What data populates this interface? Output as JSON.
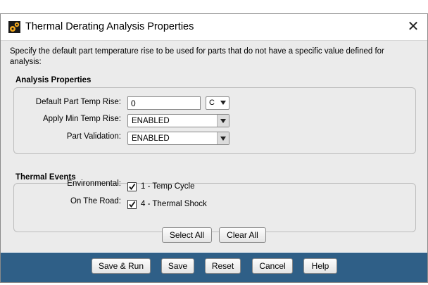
{
  "window": {
    "title": "Thermal Derating Analysis Properties",
    "close_symbol": "✕"
  },
  "description": "Specify the default part temperature rise to be used for parts that do not have a specific value defined for analysis:",
  "analysis_properties": {
    "title": "Analysis Properties",
    "default_temp_rise": {
      "label": "Default Part Temp Rise:",
      "value": "0",
      "unit": "C"
    },
    "apply_min_temp_rise": {
      "label": "Apply Min Temp Rise:",
      "value": "ENABLED"
    },
    "part_validation": {
      "label": "Part Validation:",
      "value": "ENABLED"
    }
  },
  "thermal_events": {
    "title": "Thermal Events",
    "rows": [
      {
        "label": "Environmental:",
        "item": "1 - Temp Cycle",
        "checked": true
      },
      {
        "label": "On The Road:",
        "item": "4 - Thermal Shock",
        "checked": true
      }
    ]
  },
  "buttons": {
    "select_all": "Select All",
    "clear_all": "Clear All",
    "save_run": "Save & Run",
    "save": "Save",
    "reset": "Reset",
    "cancel": "Cancel",
    "help": "Help"
  },
  "colors": {
    "footer_bg": "#2f5f87",
    "content_bg": "#ebebeb"
  }
}
